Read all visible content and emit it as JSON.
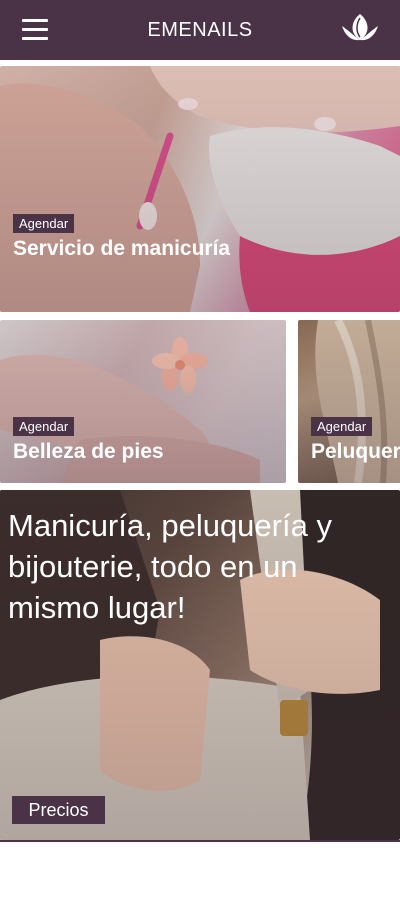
{
  "header": {
    "title": "EMENAILS",
    "menu_icon": "hamburger-menu-icon",
    "logo_icon": "lotus-logo-icon",
    "background": "#4a3247"
  },
  "cards": [
    {
      "badge": "Agendar",
      "title": "Servicio de manicuría"
    },
    {
      "badge": "Agendar",
      "title": "Belleza de pies"
    },
    {
      "badge": "Agendar",
      "title": "Peluquería"
    }
  ],
  "hero": {
    "text": "Manicuría, peluquería y bijouterie, todo en un mismo lugar!",
    "button_label": "Precios"
  },
  "colors": {
    "accent": "#4a3247",
    "text_on_accent": "#ffffff"
  }
}
